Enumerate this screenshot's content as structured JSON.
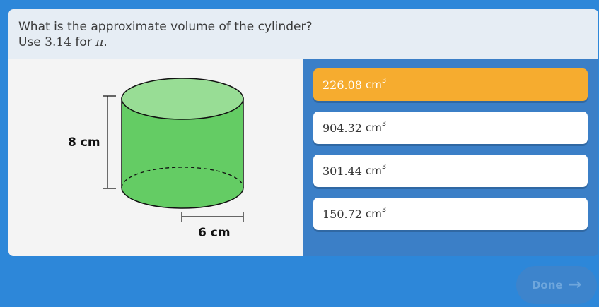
{
  "question": {
    "line1": "What is the approximate volume of the cylinder?",
    "line2_prefix": "Use ",
    "line2_number": "3.14",
    "line2_mid": " for ",
    "line2_symbol": "π",
    "line2_suffix": "."
  },
  "figure": {
    "height_label": "8 cm",
    "radius_label": "6 cm",
    "colors": {
      "body": "#64cc64",
      "top": "#98dd95",
      "panel_bg": "#f4f4f4"
    }
  },
  "answers": [
    {
      "value": "226.08",
      "unit": "cm",
      "exponent": "3",
      "selected": true
    },
    {
      "value": "904.32",
      "unit": "cm",
      "exponent": "3",
      "selected": false
    },
    {
      "value": "301.44",
      "unit": "cm",
      "exponent": "3",
      "selected": false
    },
    {
      "value": "150.72",
      "unit": "cm",
      "exponent": "3",
      "selected": false
    }
  ],
  "done_button": {
    "label": "Done",
    "icon": "arrow-right-icon"
  },
  "colors": {
    "background": "#2d87d9",
    "answers_panel": "#3b7fc7",
    "selected_answer": "#f6ac2f",
    "question_bar": "#e6edf4"
  }
}
